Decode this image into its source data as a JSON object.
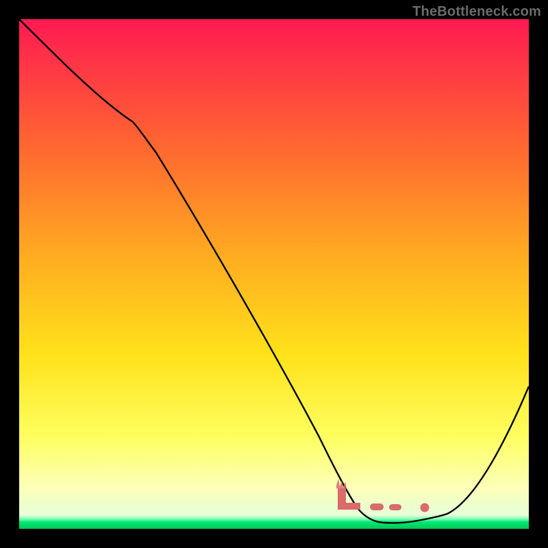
{
  "watermark": "TheBottleneck.com",
  "colors": {
    "gradient_top": "#ff1a52",
    "gradient_mid1": "#ff8a2b",
    "gradient_mid2": "#ffe81a",
    "gradient_low": "#fbff84",
    "green": "#00e676",
    "curve": "#000000",
    "marker": "#d96b6b",
    "background": "#000000"
  },
  "chart_data": {
    "type": "line",
    "title": "",
    "xlabel": "",
    "ylabel": "",
    "xlim": [
      0,
      100
    ],
    "ylim": [
      0,
      100
    ],
    "series": [
      {
        "name": "bottleneck-curve",
        "x": [
          0,
          22,
          58,
          66,
          74,
          83,
          100
        ],
        "y": [
          100,
          80,
          18,
          4,
          1,
          1.5,
          28
        ]
      }
    ],
    "markers": {
      "name": "optimal-zone",
      "points": [
        {
          "x": 63,
          "y": 5,
          "shape": "L"
        },
        {
          "x": 70,
          "y": 2,
          "shape": "dash"
        },
        {
          "x": 74,
          "y": 2,
          "shape": "dash"
        },
        {
          "x": 80,
          "y": 2,
          "shape": "dot"
        }
      ]
    },
    "legend": null,
    "grid": false,
    "annotations": []
  }
}
